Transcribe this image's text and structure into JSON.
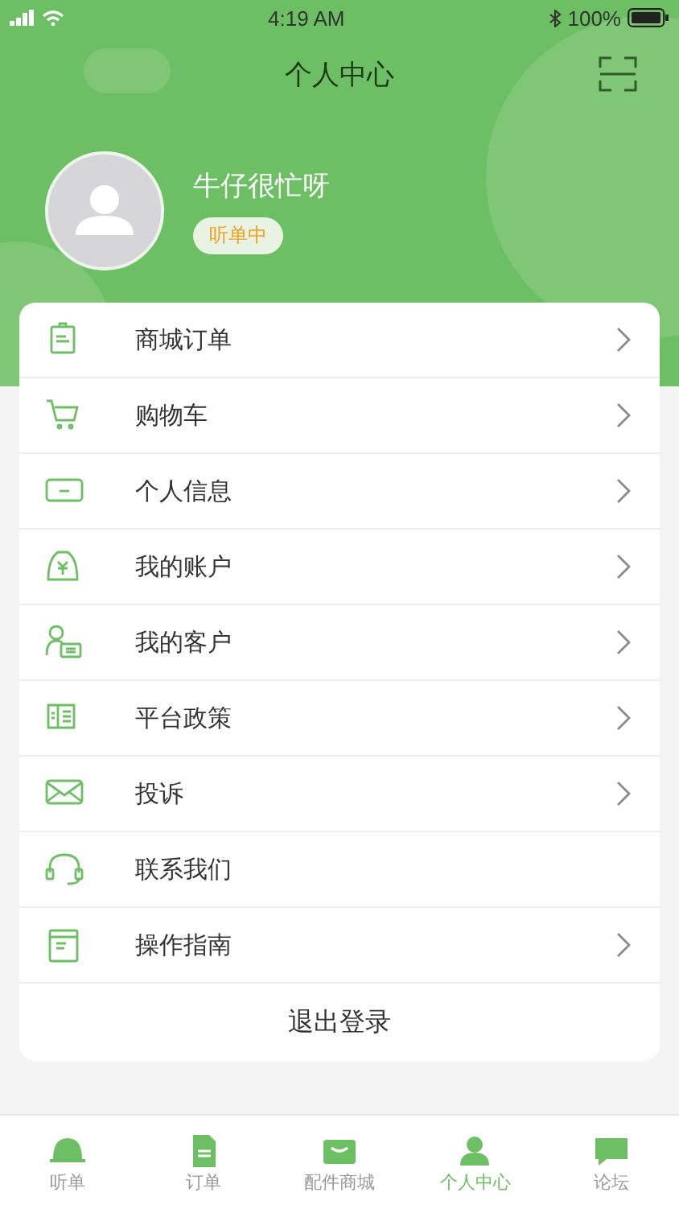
{
  "status_bar": {
    "time": "4:19 AM",
    "battery": "100%"
  },
  "header": {
    "title": "个人中心"
  },
  "profile": {
    "name": "牛仔很忙呀",
    "badge": "听单中"
  },
  "menu": [
    {
      "label": "商城订单",
      "arrow": true
    },
    {
      "label": "购物车",
      "arrow": true
    },
    {
      "label": "个人信息",
      "arrow": true
    },
    {
      "label": "我的账户",
      "arrow": true
    },
    {
      "label": "我的客户",
      "arrow": true
    },
    {
      "label": "平台政策",
      "arrow": true
    },
    {
      "label": "投诉",
      "arrow": true
    },
    {
      "label": "联系我们",
      "arrow": false
    },
    {
      "label": "操作指南",
      "arrow": true
    }
  ],
  "logout": "退出登录",
  "tabs": [
    {
      "label": "听单",
      "selected": false
    },
    {
      "label": "订单",
      "selected": false
    },
    {
      "label": "配件商城",
      "selected": false
    },
    {
      "label": "个人中心",
      "selected": true
    },
    {
      "label": "论坛",
      "selected": false
    }
  ]
}
